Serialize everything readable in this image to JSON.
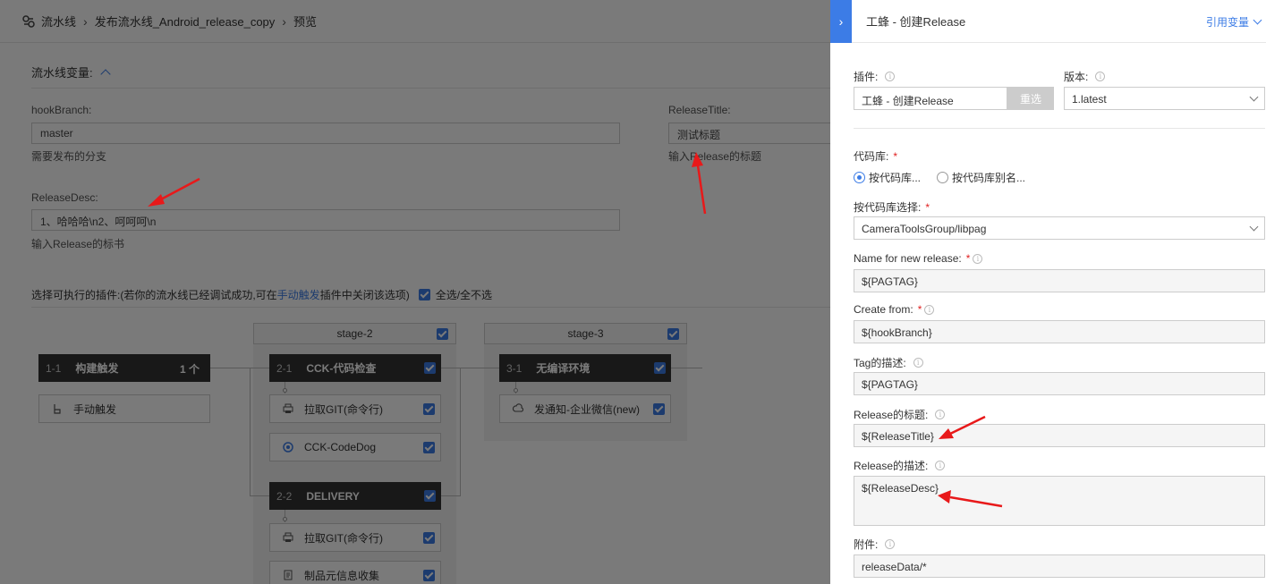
{
  "breadcrumb": {
    "root": "流水线",
    "pipeline": "发布流水线_Android_release_copy",
    "current": "预览"
  },
  "variables": {
    "section_title": "流水线变量:",
    "hookBranch": {
      "label": "hookBranch:",
      "value": "master",
      "hint": "需要发布的分支"
    },
    "releaseTitle": {
      "label": "ReleaseTitle:",
      "value": "测试标题",
      "hint": "输入Release的标题"
    },
    "releaseDesc": {
      "label": "ReleaseDesc:",
      "value": "1、哈哈哈\\n2、呵呵呵\\n",
      "hint": "输入Release的标书"
    }
  },
  "plugins": {
    "prefix": "选择可执行的插件:(若你的流水线已经调试成功,可在",
    "link": "手动触发",
    "suffix": "插件中关闭该选项)",
    "select_all": "全选/全不选"
  },
  "pipeline": {
    "stage2": "stage-2",
    "stage3": "stage-3",
    "jobs": [
      {
        "num": "1-1",
        "name": "构建触发",
        "count": "1 个"
      },
      {
        "num": "2-1",
        "name": "CCK-代码检查"
      },
      {
        "num": "2-2",
        "name": "DELIVERY"
      },
      {
        "num": "3-1",
        "name": "无编译环境"
      }
    ],
    "tasks": {
      "manual_trigger": "手动触发",
      "git_pull_1": "拉取GIT(命令行)",
      "codedog": "CCK-CodeDog",
      "notify": "发通知-企业微信(new)",
      "git_pull_2": "拉取GIT(命令行)",
      "artifact_meta": "制品元信息收集"
    }
  },
  "panel": {
    "title": "工蜂 - 创建Release",
    "ref_vars": "引用变量",
    "plugin_label": "插件:",
    "plugin_value": "工蜂 - 创建Release",
    "reselect": "重选",
    "version_label": "版本:",
    "version_value": "1.latest",
    "repo_label": "代码库:",
    "radio_by_repo": "按代码库...",
    "radio_by_alias": "按代码库别名...",
    "repo_select_label": "按代码库选择:",
    "repo_select_value": "CameraToolsGroup/libpag",
    "name_label": "Name for new release:",
    "name_value": "${PAGTAG}",
    "create_from_label": "Create from:",
    "create_from_value": "${hookBranch}",
    "tag_desc_label": "Tag的描述:",
    "tag_desc_value": "${PAGTAG}",
    "release_title_label": "Release的标题:",
    "release_title_value": "${ReleaseTitle}",
    "release_desc_label": "Release的描述:",
    "release_desc_value": "${ReleaseDesc}",
    "attach_label": "附件:",
    "attach_value": "releaseData/*"
  },
  "colors": {
    "accent": "#3c7ce6",
    "required": "#e02020",
    "annotation_arrow": "#e8191a"
  }
}
